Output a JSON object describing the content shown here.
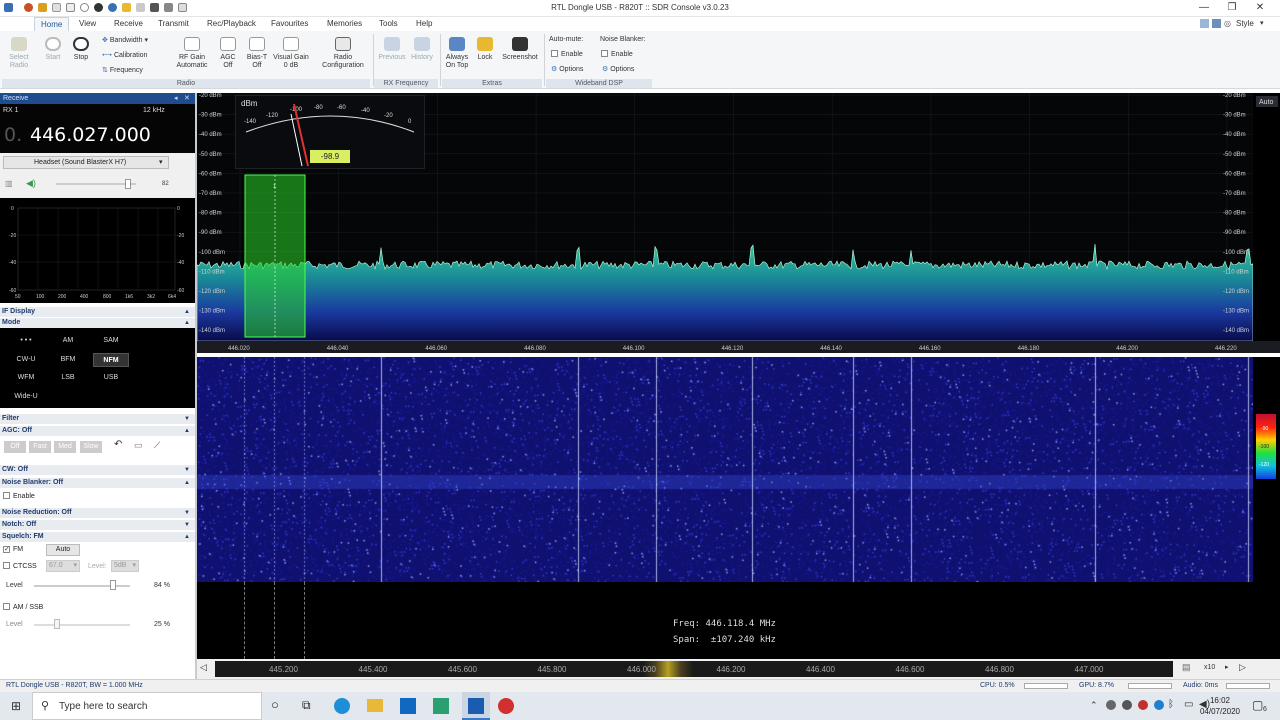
{
  "window": {
    "title": "RTL Dongle USB - R820T :: SDR Console v3.0.23",
    "style_label": "Style"
  },
  "menu": [
    "Home",
    "View",
    "Receive",
    "Transmit",
    "Rec/Playback",
    "Favourites",
    "Memories",
    "Tools",
    "Help"
  ],
  "ribbon": {
    "radio": {
      "select_radio_1": "Select",
      "select_radio_2": "Radio",
      "start": "Start",
      "stop": "Stop",
      "bandwidth": "Bandwidth",
      "calibration": "Calibration",
      "frequency": "Frequency",
      "rf_gain_1": "RF Gain",
      "rf_gain_2": "Automatic",
      "agc_1": "AGC",
      "agc_2": "Off",
      "bias_1": "Bias-T",
      "bias_2": "Off",
      "visual_gain_1": "Visual Gain",
      "visual_gain_2": "0 dB",
      "radio_config_1": "Radio",
      "radio_config_2": "Configuration",
      "group": "Radio"
    },
    "rx_frequency": {
      "previous": "Previous",
      "history": "History",
      "group": "RX Frequency"
    },
    "extras": {
      "always_on_top_1": "Always",
      "always_on_top_2": "On Top",
      "lock": "Lock",
      "screenshot": "Screenshot",
      "group": "Extras"
    },
    "wideband_dsp": {
      "auto_mute": "Auto-mute:",
      "noise_blanker": "Noise Blanker:",
      "enable": "Enable",
      "options": "Options",
      "group": "Wideband DSP"
    }
  },
  "left": {
    "receive_header": "Receive",
    "rx_label": "RX 1",
    "bandwidth": "12 kHz",
    "freq_prefix": "0.",
    "frequency": "446.027.000",
    "audio_device": "Headset (Sound BlasterX H7)",
    "volume": "82",
    "af_ticks_left": [
      "0",
      "-20",
      "-40",
      "-60"
    ],
    "af_ticks_right": [
      "0",
      "-20",
      "-40",
      "-60"
    ],
    "af_x_ticks": [
      "50",
      "100",
      "200",
      "400",
      "800",
      "1k6",
      "3k2",
      "6k4"
    ],
    "if_display": "IF Display",
    "mode_header": "Mode",
    "modes": [
      "AM",
      "SAM",
      "CW-U",
      "BFM",
      "NFM",
      "WFM",
      "LSB",
      "USB",
      "Wide-U"
    ],
    "mode_more": "• • •",
    "selected_mode": "NFM",
    "filter": "Filter",
    "agc": "AGC: Off",
    "agc_buttons": [
      "Off",
      "Fast",
      "Med",
      "Slow"
    ],
    "cw": "CW: Off",
    "noise_blanker": "Noise Blanker: Off",
    "nb_enable": "Enable",
    "noise_reduction": "Noise Reduction: Off",
    "notch": "Notch: Off",
    "squelch": "Squelch: FM",
    "fm": "FM",
    "auto": "Auto",
    "ctcss": "CTCSS",
    "ctcss_value": "67.0",
    "level_label": "Level:",
    "level_db": "5dB",
    "level": "Level",
    "level_pct": "84 %",
    "am_ssb": "AM / SSB",
    "level2": "Level",
    "level2_pct": "25 %"
  },
  "spectrum": {
    "auto": "Auto",
    "dbm_label": "dBm",
    "meter_ticks": [
      "-140",
      "-120",
      "-100",
      "-80",
      "-60",
      "-40",
      "-20",
      "0"
    ],
    "meter_value": "-98.9",
    "marker": "1",
    "db_labels": [
      "-20 dBm",
      "-30 dBm",
      "-40 dBm",
      "-50 dBm",
      "-60 dBm",
      "-70 dBm",
      "-80 dBm",
      "-90 dBm",
      "-100 dBm",
      "-110 dBm",
      "-120 dBm",
      "-130 dBm",
      "-140 dBm"
    ],
    "freq_ticks": [
      "446.020",
      "446.040",
      "446.060",
      "446.080",
      "446.100",
      "446.120",
      "446.140",
      "446.160",
      "446.180",
      "446.200",
      "446.220"
    ],
    "colorbar_ticks": [
      "-90",
      "-100",
      "-120"
    ]
  },
  "info": {
    "freq": "Freq: 446.118.4 MHz",
    "span": "Span:  ±107.240 kHz"
  },
  "overview": {
    "ticks": [
      "445.200",
      "445.400",
      "445.600",
      "445.800",
      "446.000",
      "446.200",
      "446.400",
      "446.600",
      "446.800",
      "447.000"
    ],
    "zoom": "x10"
  },
  "status": {
    "left": "RTL Dongle USB - R820T, BW = 1.000 MHz",
    "cpu": "CPU: 0.5%",
    "gpu": "GPU: 8.7%",
    "audio": "Audio: 0ms"
  },
  "taskbar": {
    "search_placeholder": "Type here to search",
    "time": "16:02",
    "date": "04/07/2020",
    "notifications": "6"
  }
}
